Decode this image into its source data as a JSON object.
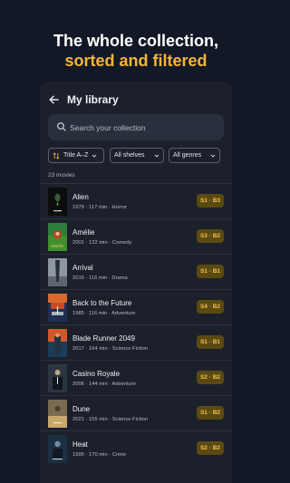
{
  "headline": {
    "line1": "The whole collection,",
    "line2": "sorted and filtered"
  },
  "appbar": {
    "title": "My library",
    "back_icon": "arrow-left-icon"
  },
  "search": {
    "placeholder": "Search your collection",
    "icon": "search-icon"
  },
  "filters": {
    "sort_label": "Title A–Z",
    "shelves_label": "All shelves",
    "genres_label": "All genres"
  },
  "count_label": "23 movies",
  "colors": {
    "background": "#131826",
    "accent": "#f5b53a",
    "badge_bg": "#5a4a12",
    "badge_text": "#f2c14e"
  },
  "movies": [
    {
      "title": "Alien",
      "meta": "1979 · 117 min · Horror",
      "badge": "S1 · B3"
    },
    {
      "title": "Amélie",
      "meta": "2001 · 122 min · Comedy",
      "badge": "S3 · B2"
    },
    {
      "title": "Arrival",
      "meta": "2016 · 116 min · Drama",
      "badge": "S1 · B1"
    },
    {
      "title": "Back to the Future",
      "meta": "1985 · 116 min · Adventure",
      "badge": "S4 · B2"
    },
    {
      "title": "Blade Runner 2049",
      "meta": "2017 · 164 min · Science Fiction",
      "badge": "S1 · B1"
    },
    {
      "title": "Casino Royale",
      "meta": "2006 · 144 min · Adventure",
      "badge": "S2 · B2"
    },
    {
      "title": "Dune",
      "meta": "2021 · 155 min · Science Fiction",
      "badge": "S1 · B2"
    },
    {
      "title": "Heat",
      "meta": "1995 · 170 min · Crime",
      "badge": "S2 · B2"
    }
  ]
}
